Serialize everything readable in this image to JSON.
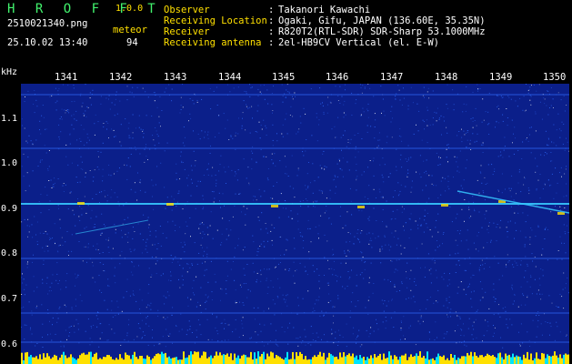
{
  "header": {
    "brand": "H R O F F T",
    "version": "1.0.0",
    "filename": "2510021340.png",
    "meteor_label": "meteor",
    "datetime": "25.10.02 13:40",
    "meteor_count": "94",
    "info": [
      {
        "key": "Observer",
        "value": "Takanori Kawachi"
      },
      {
        "key": "Receiving Location",
        "value": "Ogaki, Gifu, JAPAN (136.60E, 35.35N)"
      },
      {
        "key": "Receiver",
        "value": "R820T2(RTL-SDR) SDR-Sharp 53.1000MHz"
      },
      {
        "key": "Receiving antenna",
        "value": "2el-HB9CV Vertical (el. E-W)"
      }
    ],
    "separator": ":"
  },
  "spectrogram": {
    "unit": "kHz",
    "time_ticks": [
      "1341",
      "1342",
      "1343",
      "1344",
      "1345",
      "1346",
      "1347",
      "1348",
      "1349",
      "1350"
    ],
    "freq_ticks": [
      "1.1",
      "1.0",
      "0.9",
      "0.8",
      "0.7",
      "0.6"
    ],
    "colors": {
      "background": "#0b1f8a",
      "noise": "#2f6cff",
      "carrier": "#37c8ff",
      "echo": "#ffe000",
      "baseline": "#ffe000",
      "baseline_alt": "#00e5ff"
    }
  }
}
